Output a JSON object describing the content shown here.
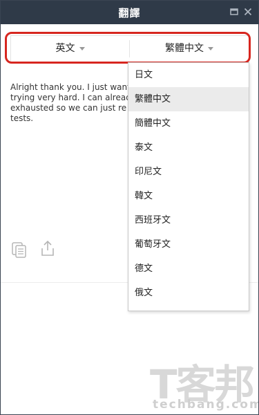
{
  "window": {
    "title": "翻譯",
    "min_icon": "minimize-icon",
    "close_icon": "close-icon"
  },
  "languages": {
    "source": "英文",
    "target": "繁體中文"
  },
  "source_text": [
    "Alright thank you. I just want",
    "trying very hard. I can alread",
    "exhausted so we can just re",
    "tests."
  ],
  "actions": {
    "copy_icon": "copy-icon",
    "share_icon": "share-icon"
  },
  "dropdown": {
    "items": [
      "日文",
      "繁體中文",
      "簡體中文",
      "泰文",
      "印尼文",
      "韓文",
      "西班牙文",
      "葡萄牙文",
      "德文",
      "俄文"
    ],
    "selected": "繁體中文"
  },
  "watermark": {
    "brand": "T客邦",
    "domain": "techbang.com"
  },
  "colors": {
    "titlebar": "#2f3a48",
    "highlight": "#d7261f",
    "selected_bg": "#ebebeb"
  }
}
